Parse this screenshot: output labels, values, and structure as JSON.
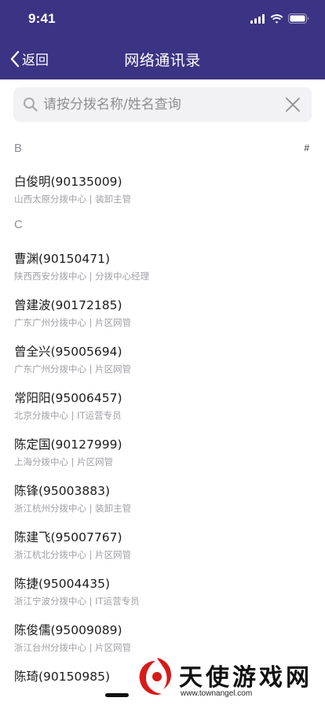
{
  "status_bar": {
    "time": "9:41"
  },
  "nav": {
    "back_label": "返回",
    "title": "网络通讯录"
  },
  "search": {
    "placeholder": "请按分拨名称/姓名查询",
    "value": ""
  },
  "index": {
    "hash": "#"
  },
  "sections": [
    {
      "letter": "B"
    },
    {
      "letter": "C"
    }
  ],
  "contacts": [
    {
      "name": "白俊明(90135009)",
      "sub": "山西太原分拨中心 | 装卸主管"
    },
    {
      "name": "曹渊(90150471)",
      "sub": "陕西西安分拨中心 | 分拨中心经理"
    },
    {
      "name": "曾建波(90172185)",
      "sub": "广东广州分拨中心 | 片区网管"
    },
    {
      "name": "曾全兴(95005694)",
      "sub": "广东广州分拨中心 | 片区网管"
    },
    {
      "name": "常阳阳(95006457)",
      "sub": "北京分拨中心 | IT运营专员"
    },
    {
      "name": "陈定国(90127999)",
      "sub": "上海分拨中心 | 片区网管"
    },
    {
      "name": "陈锋(95003883)",
      "sub": "浙江杭州分拨中心 | 装卸主管"
    },
    {
      "name": "陈建飞(95007767)",
      "sub": "浙江杭北分拨中心 | 片区网管"
    },
    {
      "name": "陈捷(95004435)",
      "sub": "浙江宁波分拨中心 | IT运营专员"
    },
    {
      "name": "陈俊儒(95009089)",
      "sub": "浙江台州分拨中心 | 片区网管"
    },
    {
      "name": "陈琦(90150985)",
      "sub": ""
    }
  ],
  "watermark": {
    "text": "天使游戏网",
    "url": "www.townangel.com"
  },
  "colors": {
    "header": "#3b3384",
    "search_bg": "#f2f2f4",
    "secondary_text": "#a0a0a6"
  }
}
